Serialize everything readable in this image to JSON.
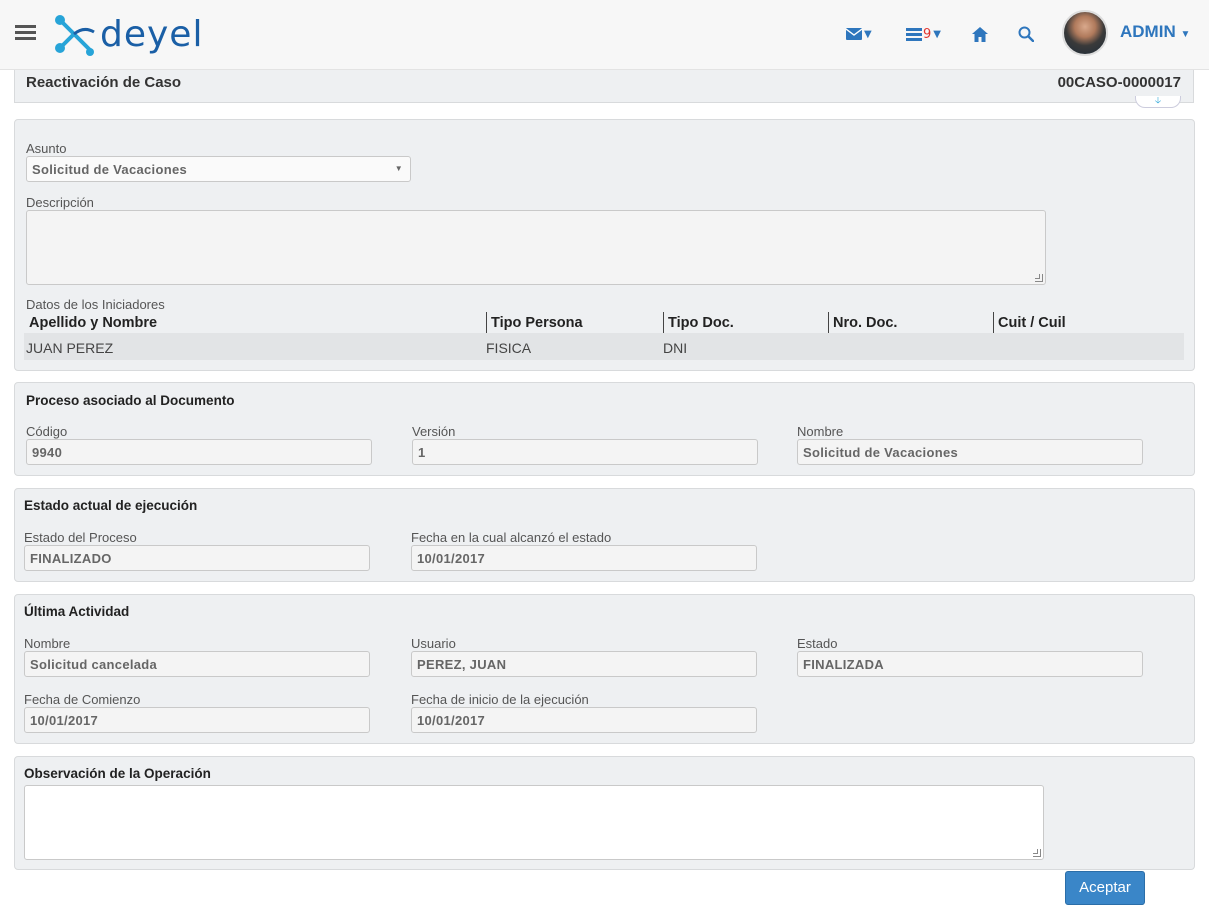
{
  "header": {
    "logo_text": "deyel",
    "notifications_count": "9",
    "user": "ADMIN",
    "icons": [
      "menu-icon",
      "mail-icon",
      "task-list-icon",
      "home-icon",
      "search-icon"
    ]
  },
  "titlebar": {
    "title": "Reactivación de Caso",
    "case_id": "00CASO-0000017"
  },
  "case": {
    "asunto_label": "Asunto",
    "asunto_value": "Solicitud de Vacaciones",
    "descripcion_label": "Descripción",
    "descripcion_value": "",
    "iniciadores_label": "Datos de los Iniciadores",
    "columns": [
      "Apellido y Nombre",
      "Tipo Persona",
      "Tipo Doc.",
      "Nro. Doc.",
      "Cuit / Cuil"
    ],
    "rows": [
      [
        "JUAN PEREZ",
        "FISICA",
        "DNI",
        "",
        ""
      ]
    ]
  },
  "proceso": {
    "title": "Proceso asociado al Documento",
    "codigo_label": "Código",
    "codigo_value": "9940",
    "version_label": "Versión",
    "version_value": "1",
    "nombre_label": "Nombre",
    "nombre_value": "Solicitud de Vacaciones"
  },
  "estado": {
    "title": "Estado actual de ejecución",
    "estado_label": "Estado del Proceso",
    "estado_value": "FINALIZADO",
    "fecha_label": "Fecha en la cual alcanzó el estado",
    "fecha_value": "10/01/2017"
  },
  "actividad": {
    "title": "Última Actividad",
    "nombre_label": "Nombre",
    "nombre_value": "Solicitud cancelada",
    "usuario_label": "Usuario",
    "usuario_value": "PEREZ, JUAN",
    "estado_label": "Estado",
    "estado_value": "FINALIZADA",
    "comienzo_label": "Fecha de Comienzo",
    "comienzo_value": "10/01/2017",
    "inicio_label": "Fecha de inicio de la ejecución",
    "inicio_value": "10/01/2017"
  },
  "observacion": {
    "title": "Observación de la Operación",
    "value": ""
  },
  "actions": {
    "accept_label": "Aceptar"
  },
  "colors": {
    "brand": "#1a5fa6",
    "accent": "#2e76bd",
    "button": "#3a86c8",
    "badge": "#e0342f"
  }
}
